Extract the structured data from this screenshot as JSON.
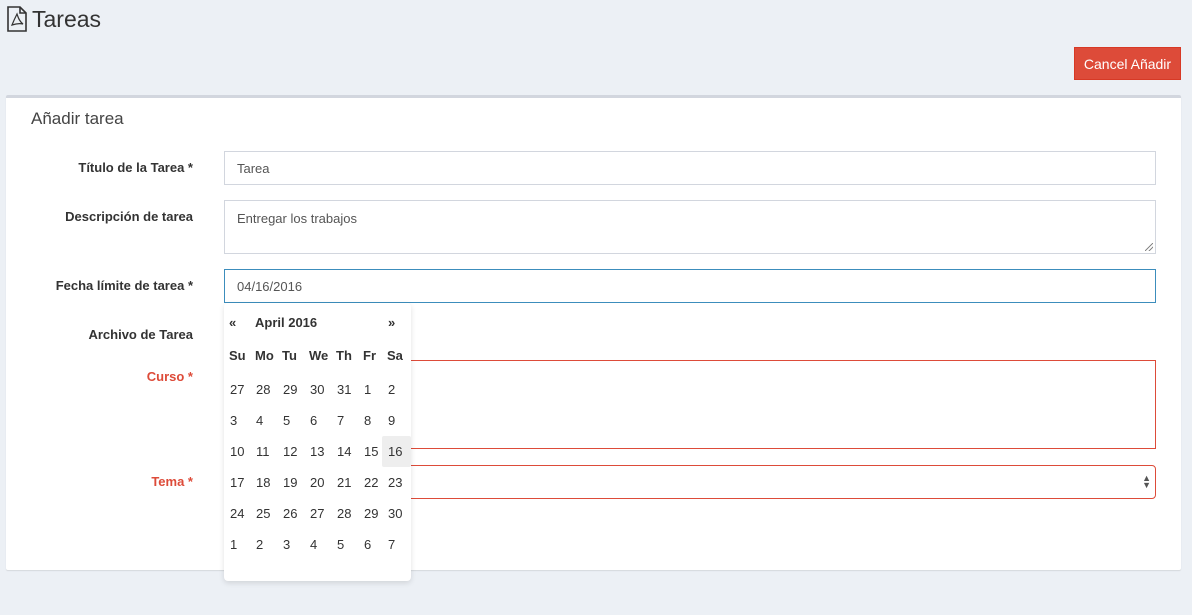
{
  "header": {
    "title": "Tareas",
    "icon": "pdf-file-icon"
  },
  "actions": {
    "cancel_label": "Cancel Añadir"
  },
  "box": {
    "title": "Añadir tarea"
  },
  "form": {
    "title_label": "Título de la Tarea *",
    "title_value": "Tarea",
    "description_label": "Descripción de tarea",
    "description_value": "Entregar los trabajos",
    "due_label": "Fecha límite de tarea *",
    "due_value": "04/16/2016",
    "file_label": "Archivo de Tarea",
    "course_label": "Curso *",
    "topic_label": "Tema *"
  },
  "datepicker": {
    "prev": "«",
    "next": "»",
    "month": "April 2016",
    "weekdays": [
      "Su",
      "Mo",
      "Tu",
      "We",
      "Th",
      "Fr",
      "Sa"
    ],
    "weeks": [
      [
        "27",
        "28",
        "29",
        "30",
        "31",
        "1",
        "2"
      ],
      [
        "3",
        "4",
        "5",
        "6",
        "7",
        "8",
        "9"
      ],
      [
        "10",
        "11",
        "12",
        "13",
        "14",
        "15",
        "16"
      ],
      [
        "17",
        "18",
        "19",
        "20",
        "21",
        "22",
        "23"
      ],
      [
        "24",
        "25",
        "26",
        "27",
        "28",
        "29",
        "30"
      ],
      [
        "1",
        "2",
        "3",
        "4",
        "5",
        "6",
        "7"
      ]
    ],
    "selected": "16"
  },
  "colors": {
    "danger": "#dd4b39",
    "focus": "#3c8dbc",
    "background": "#ecf0f5"
  }
}
